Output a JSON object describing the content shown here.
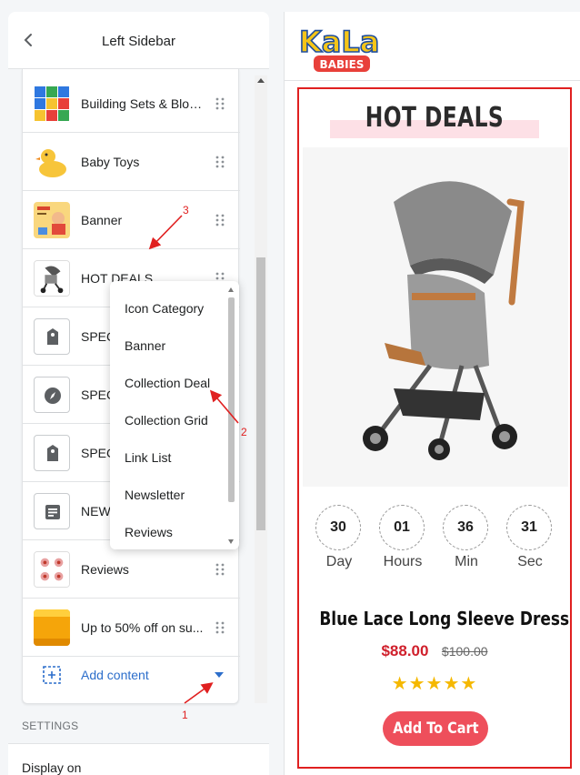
{
  "sidebar": {
    "title": "Left Sidebar",
    "items": [
      {
        "label": "Building Sets & Blocks",
        "thumb": "building-blocks"
      },
      {
        "label": "Baby Toys",
        "thumb": "rubber-duck"
      },
      {
        "label": "Banner",
        "thumb": "banner-kids"
      },
      {
        "label": "HOT DEALS",
        "thumb": "stroller"
      },
      {
        "label": "SPECI",
        "thumb": "tag-icon"
      },
      {
        "label": "SPECI",
        "thumb": "compass-icon"
      },
      {
        "label": "SPECI",
        "thumb": "tag-icon"
      },
      {
        "label": "NEWS",
        "thumb": "newsletter-icon"
      },
      {
        "label": "Reviews",
        "thumb": "reviews-thumb"
      },
      {
        "label": "Up to 50% off on su...",
        "thumb": "orange-banner"
      }
    ],
    "add_content": "Add content",
    "settings_title": "SETTINGS",
    "display_on": "Display on"
  },
  "dropdown": {
    "options": [
      "Icon Category",
      "Banner",
      "Collection Deal",
      "Collection Grid",
      "Link List",
      "Newsletter",
      "Reviews"
    ]
  },
  "annotations": {
    "a1": "1",
    "a2": "2",
    "a3": "3"
  },
  "preview": {
    "logo_line1": "KaLa",
    "logo_line2": "BABIES",
    "section_title": "HOT DEALS",
    "countdown": [
      {
        "value": "30",
        "unit": "Day"
      },
      {
        "value": "01",
        "unit": "Hours"
      },
      {
        "value": "36",
        "unit": "Min"
      },
      {
        "value": "31",
        "unit": "Sec"
      }
    ],
    "product_name": "Blue Lace Long Sleeve Dress",
    "price_new": "$88.00",
    "price_old": "$100.00",
    "rating": "★★★★★",
    "cart_label": "Add To Cart"
  },
  "colors": {
    "accent": "#2c6ecb",
    "annotation": "#e02020",
    "price": "#d0202c",
    "cart": "#ee4f5b",
    "star": "#f5b800"
  }
}
